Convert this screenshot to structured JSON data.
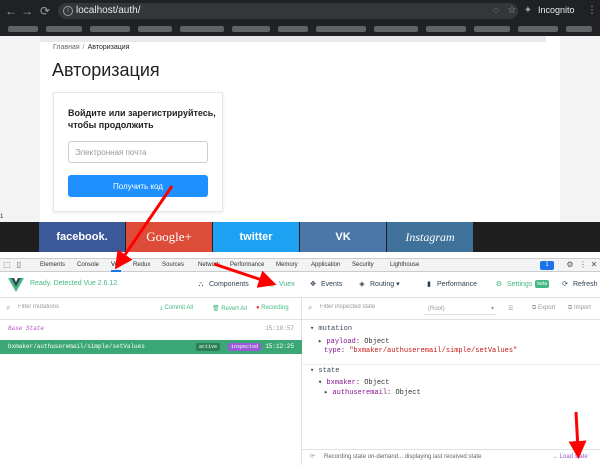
{
  "browser": {
    "url": "localhost/auth/",
    "incognito_label": "Incognito"
  },
  "page": {
    "breadcrumb_home": "Главная",
    "breadcrumb_current": "Авторизация",
    "title": "Авторизация",
    "card_heading": "Войдите или зарегистрируйтесь, чтобы продолжить",
    "email_placeholder": "Электронная почта",
    "submit_label": "Получить код",
    "edge_label": "1"
  },
  "social": {
    "facebook": "facebook.",
    "googleplus": "Google+",
    "twitter": "twitter",
    "vk": "VK",
    "instagram": "Instagram"
  },
  "devtools": {
    "tabs": [
      "Elements",
      "Console",
      "Vue",
      "Redux",
      "Sources",
      "Network",
      "Performance",
      "Memory",
      "Application",
      "Security",
      "Lighthouse"
    ],
    "badge": "1"
  },
  "vue": {
    "status": "Ready. Detected Vue 2.6.12.",
    "tabs": {
      "components": "Components",
      "vuex": "Vuex",
      "events": "Events",
      "routing": "Routing",
      "performance": "Performance",
      "settings": "Settings",
      "beta": "beta",
      "refresh": "Refresh"
    },
    "left": {
      "filter_placeholder": "Filter mutations",
      "commit_all": "Commit All",
      "revert_all": "Revert All",
      "recording": "Recording",
      "base_state": "Base State",
      "base_time": "15:10:57",
      "mutation_name": "bxmaker/authuseremail/simple/setValues",
      "tag_active": "active",
      "tag_inspected": "inspected",
      "mutation_time": "15:12:25"
    },
    "right": {
      "filter_placeholder": "Filter inspected state",
      "root": "(Root)",
      "export": "Export",
      "import": "Import",
      "mutation_label": "mutation",
      "payload_key": "payload",
      "payload_val": "Object",
      "type_key": "type",
      "type_val": "\"bxmaker/authuseremail/simple/setValues\"",
      "state_label": "state",
      "bxmaker_key": "bxmaker",
      "bxmaker_val": "Object",
      "authuseremail_key": "authuseremail",
      "authuseremail_val": "Object",
      "status_text": "Recording state on-demand... displaying last received state",
      "load_state": "Load state"
    }
  },
  "colors": {
    "vue_green": "#42b883",
    "arrow_red": "#ff0000"
  }
}
